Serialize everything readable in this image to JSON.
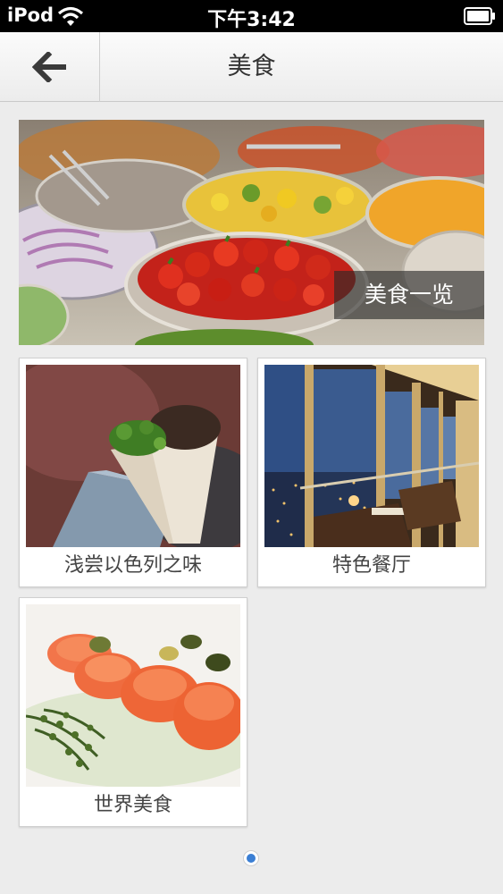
{
  "status_bar": {
    "carrier": "iPod",
    "time": "下午3:42"
  },
  "nav": {
    "title": "美食",
    "back_icon": "back-arrow-icon"
  },
  "banner": {
    "caption": "美食一览",
    "image": "salad-bar-photo"
  },
  "tiles": [
    {
      "label": "浅尝以色列之味",
      "image": "wrap-sandwich-photo"
    },
    {
      "label": "特色餐厅",
      "image": "restaurant-city-view-photo"
    },
    {
      "label": "世界美食",
      "image": "salmon-rolls-photo"
    }
  ],
  "pager": {
    "active_color": "#3b7fd4"
  }
}
